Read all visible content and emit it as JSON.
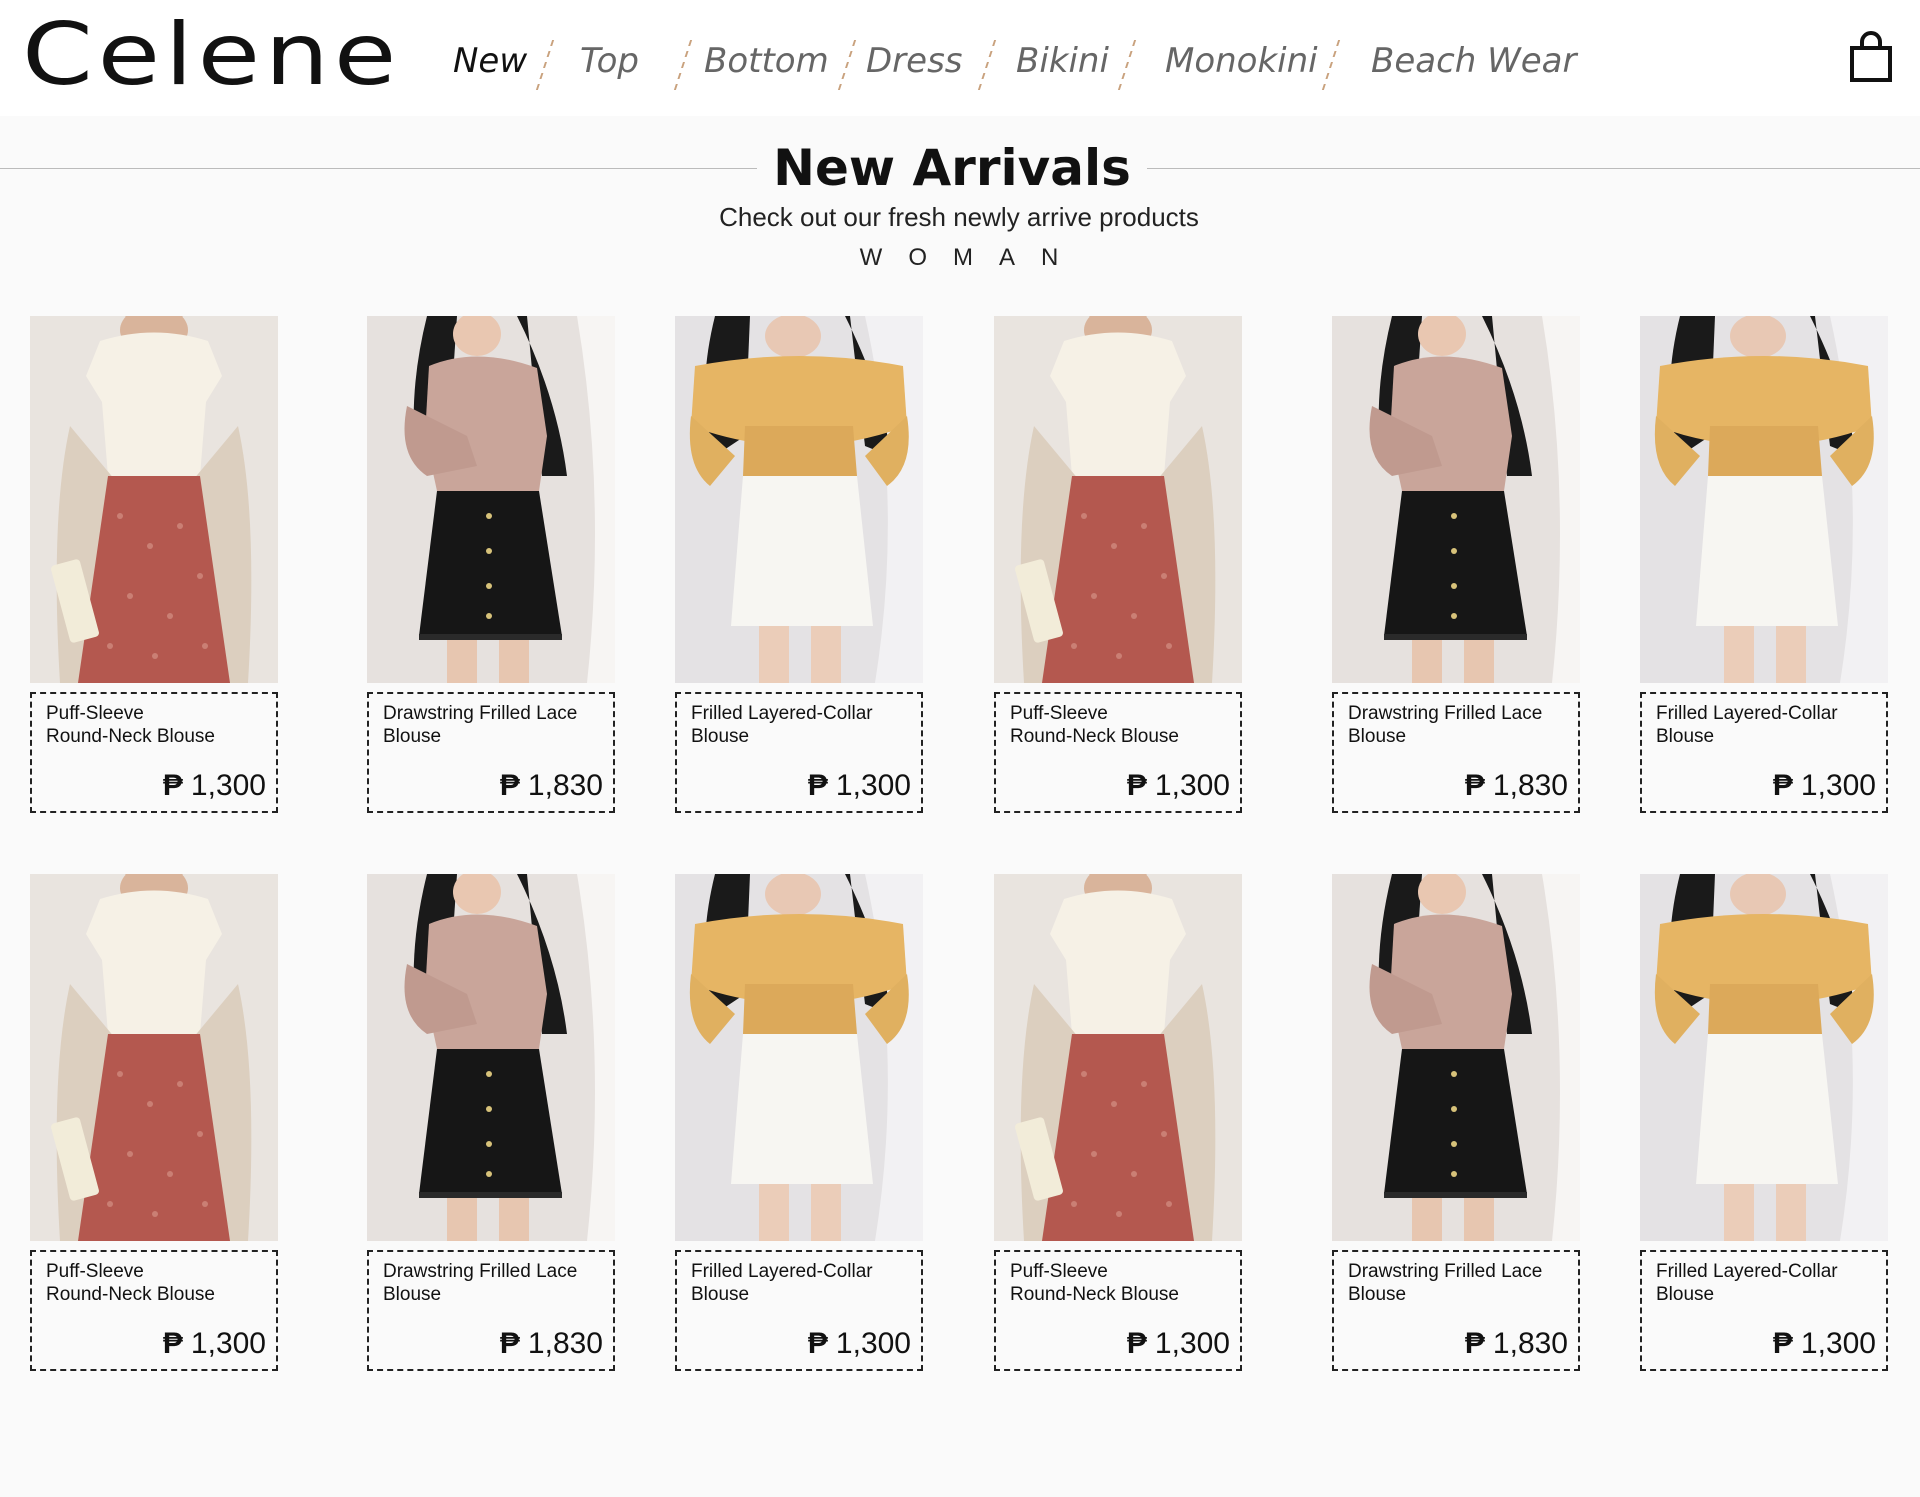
{
  "brand": {
    "name": "Celene"
  },
  "nav": {
    "items": [
      "New",
      "Top",
      "Bottom",
      "Dress",
      "Bikini",
      "Monokini",
      "Beach Wear"
    ],
    "active": "New"
  },
  "cart": {
    "icon": "shopping-bag-icon"
  },
  "section": {
    "title": "New Arrivals",
    "subtitle": "Check out our fresh newly arrive products",
    "category": "WOMAN"
  },
  "currency_symbol": "₱",
  "products": [
    {
      "name_line1": "Puff-Sleeve",
      "name_line2": "Round-Neck Blouse",
      "price": "1,300",
      "photo": "white-knit-top-red-floral-skirt"
    },
    {
      "name_line1": "Drawstring Frilled Lace",
      "name_line2": "Blouse",
      "price": "1,830",
      "photo": "pink-knit-sweater-black-skirt"
    },
    {
      "name_line1": "Frilled Layered-Collar",
      "name_line2": "Blouse",
      "price": "1,300",
      "photo": "mustard-ruffle-top-white-skirt"
    },
    {
      "name_line1": "Puff-Sleeve",
      "name_line2": "Round-Neck Blouse",
      "price": "1,300",
      "photo": "white-knit-top-red-floral-skirt"
    },
    {
      "name_line1": "Drawstring Frilled Lace",
      "name_line2": "Blouse",
      "price": "1,830",
      "photo": "pink-knit-sweater-black-skirt"
    },
    {
      "name_line1": "Frilled Layered-Collar",
      "name_line2": "Blouse",
      "price": "1,300",
      "photo": "mustard-ruffle-top-white-skirt"
    },
    {
      "name_line1": "Puff-Sleeve",
      "name_line2": "Round-Neck Blouse",
      "price": "1,300",
      "photo": "white-knit-top-red-floral-skirt"
    },
    {
      "name_line1": "Drawstring Frilled Lace",
      "name_line2": "Blouse",
      "price": "1,830",
      "photo": "pink-knit-sweater-black-skirt"
    },
    {
      "name_line1": "Frilled Layered-Collar",
      "name_line2": "Blouse",
      "price": "1,300",
      "photo": "mustard-ruffle-top-white-skirt"
    },
    {
      "name_line1": "Puff-Sleeve",
      "name_line2": "Round-Neck Blouse",
      "price": "1,300",
      "photo": "white-knit-top-red-floral-skirt"
    },
    {
      "name_line1": "Drawstring Frilled Lace",
      "name_line2": "Blouse",
      "price": "1,830",
      "photo": "pink-knit-sweater-black-skirt"
    },
    {
      "name_line1": "Frilled Layered-Collar",
      "name_line2": "Blouse",
      "price": "1,300",
      "photo": "mustard-ruffle-top-white-skirt"
    }
  ],
  "colors": {
    "accent_separator": "#c9a27e",
    "nav_inactive": "#666666",
    "text": "#111111"
  }
}
